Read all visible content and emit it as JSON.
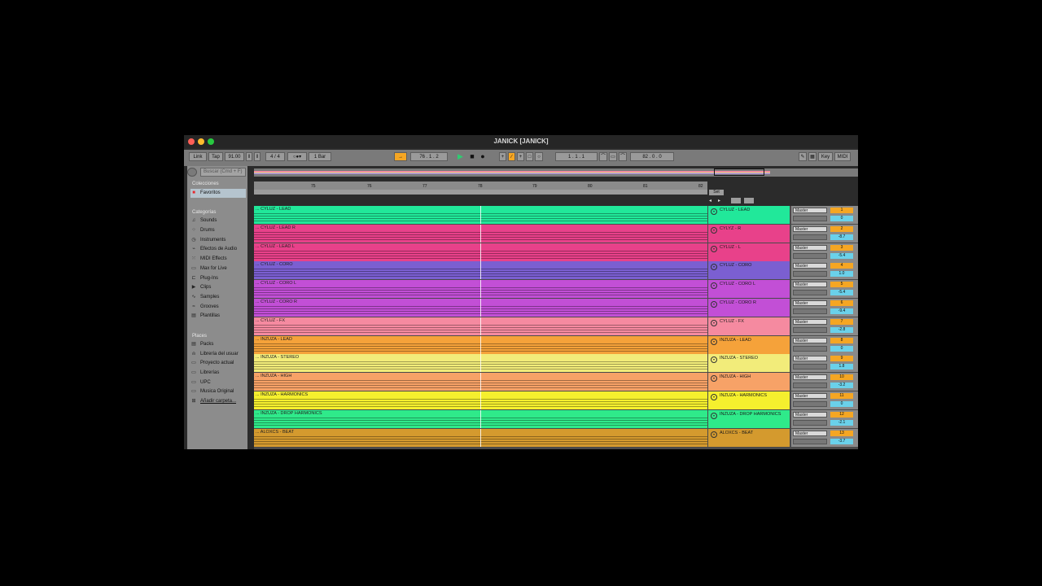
{
  "window": {
    "title": "JANICK  [JANICK]"
  },
  "transport": {
    "link": "Link",
    "tap": "Tap",
    "tempo": "91.00",
    "signature": "4 / 4",
    "quantize": "1 Bar",
    "position": "76 .  1 .  2",
    "loop_start": "1 .  1 .  1",
    "loop_length": "82 .  0 .  0",
    "key": "Key",
    "midi": "MIDI"
  },
  "browser": {
    "search_placeholder": "Buscar (Cmd + F)",
    "collections_label": "Colecciones",
    "favorites": "Favoritos",
    "categories_label": "Categorías",
    "categories": [
      {
        "label": "Sounds",
        "icon": "music-note-icon"
      },
      {
        "label": "Drums",
        "icon": "drums-icon"
      },
      {
        "label": "Instruments",
        "icon": "instrument-icon"
      },
      {
        "label": "Efectos de Audio",
        "icon": "audio-effect-icon"
      },
      {
        "label": "MIDI Effects",
        "icon": "midi-effect-icon"
      },
      {
        "label": "Max for Live",
        "icon": "max-icon"
      },
      {
        "label": "Plug-Ins",
        "icon": "plugin-icon"
      },
      {
        "label": "Clips",
        "icon": "clip-icon"
      },
      {
        "label": "Samples",
        "icon": "sample-icon"
      },
      {
        "label": "Grooves",
        "icon": "groove-icon"
      },
      {
        "label": "Plantillas",
        "icon": "template-icon"
      }
    ],
    "places_label": "Places",
    "places": [
      {
        "label": "Packs"
      },
      {
        "label": "Librería del usuar"
      },
      {
        "label": "Proyecto actual"
      },
      {
        "label": "Librerías"
      },
      {
        "label": "UPC"
      },
      {
        "label": "Musica Original"
      },
      {
        "label": "Añadir carpeta..."
      }
    ]
  },
  "ruler": {
    "bars": [
      "75",
      "76",
      "77",
      "78",
      "79",
      "80",
      "81",
      "82"
    ],
    "set_label": "Set"
  },
  "tracks": [
    {
      "clip": "... CYLUZ - LEAD",
      "name": "CYLUZ - LEAD",
      "color": "#21e89a",
      "output": "Master",
      "number": "1",
      "volume": "0"
    },
    {
      "clip": "... CYLUZ - LEAD R",
      "name": "CYLYZ - R",
      "color": "#e8418a",
      "output": "Master",
      "number": "2",
      "volume": "-8.7"
    },
    {
      "clip": "... CYLUZ - LEAD L",
      "name": "CYLUZ - L",
      "color": "#e8418a",
      "output": "Master",
      "number": "3",
      "volume": "-5.4"
    },
    {
      "clip": "... CYLUZ - CORO",
      "name": "CYLUZ - CORO",
      "color": "#7b5fd1",
      "output": "Master",
      "number": "4",
      "volume": "1.0"
    },
    {
      "clip": "... CYLUZ - CORO L",
      "name": "CYLUZ - CORO L",
      "color": "#c24fd6",
      "output": "Master",
      "number": "5",
      "volume": "-5.4"
    },
    {
      "clip": "... CYLUZ - CORO R",
      "name": "CYLUZ - CORO R",
      "color": "#c24fd6",
      "output": "Master",
      "number": "6",
      "volume": "-9.4"
    },
    {
      "clip": "... CYLUZ - FX",
      "name": "CYLUZ - FX",
      "color": "#f58aa0",
      "output": "Master",
      "number": "7",
      "volume": "-2.8"
    },
    {
      "clip": "... INZUZA - LEAD",
      "name": "INZUZA - LEAD",
      "color": "#f5a23a",
      "output": "Master",
      "number": "8",
      "volume": "0"
    },
    {
      "clip": "... INZUZA - STEREO",
      "name": "INZUZA - STEREO",
      "color": "#f2ec7a",
      "output": "Master",
      "number": "9",
      "volume": "1.8"
    },
    {
      "clip": "... INZUZA - HIGH",
      "name": "INZUZA - HIGH",
      "color": "#f7a267",
      "output": "Master",
      "number": "10",
      "volume": "-3.2"
    },
    {
      "clip": "... INZUZA - HARMONICS",
      "name": "INZUZA - HARMONICS",
      "color": "#f5ef2e",
      "output": "Master",
      "number": "11",
      "volume": "0"
    },
    {
      "clip": "... INZUZA - DROP HARMONICS",
      "name": "INZUZA - DROP HARMONICS",
      "color": "#2fea8a",
      "output": "Master",
      "number": "12",
      "volume": "-2.1"
    },
    {
      "clip": "... ALOXCS - BEAT",
      "name": "ALOXCS - BEAT",
      "color": "#d49a2e",
      "output": "Master",
      "number": "13",
      "volume": "-3.7"
    }
  ]
}
